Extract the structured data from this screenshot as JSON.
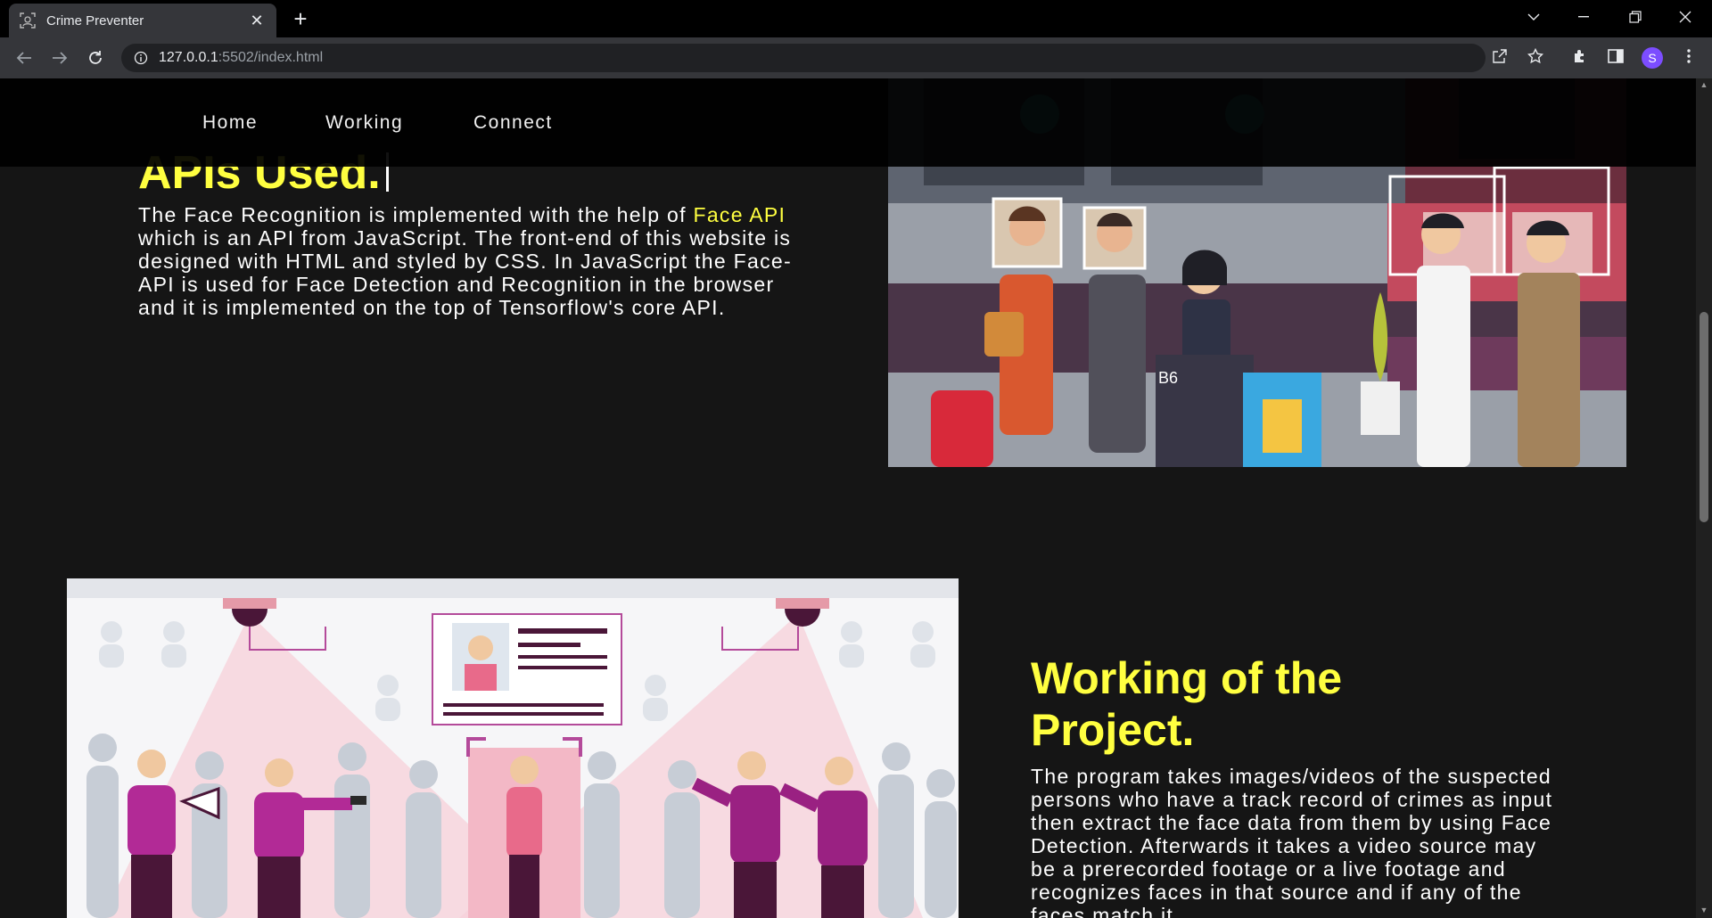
{
  "browser": {
    "tab_title": "Crime Preventer",
    "url_host": "127.0.0.1",
    "url_rest": ":5502/index.html",
    "profile_initial": "S"
  },
  "nav": {
    "home": "Home",
    "working": "Working",
    "connect": "Connect"
  },
  "apis": {
    "heading": "APIs Used.",
    "text_before": "The Face Recognition is implemented with the help of ",
    "highlight": "Face API",
    "text_after": " which is an API from JavaScript. The front-end of this website is designed with HTML and styled by CSS. In JavaScript the Face-API is used for Face Detection and Recognition in the browser and it is implemented on the top of Tensorflow's core API."
  },
  "working": {
    "heading": "Working of the Project.",
    "text": "The program takes images/videos of the suspected persons who have a track record of crimes as input then extract the face data from them by using Face Detection. Afterwards it takes a video source may be a prerecorded footage or a live footage and recognizes faces in that source and if any of the faces match it"
  },
  "illustration_text": {
    "counter": "B6"
  }
}
